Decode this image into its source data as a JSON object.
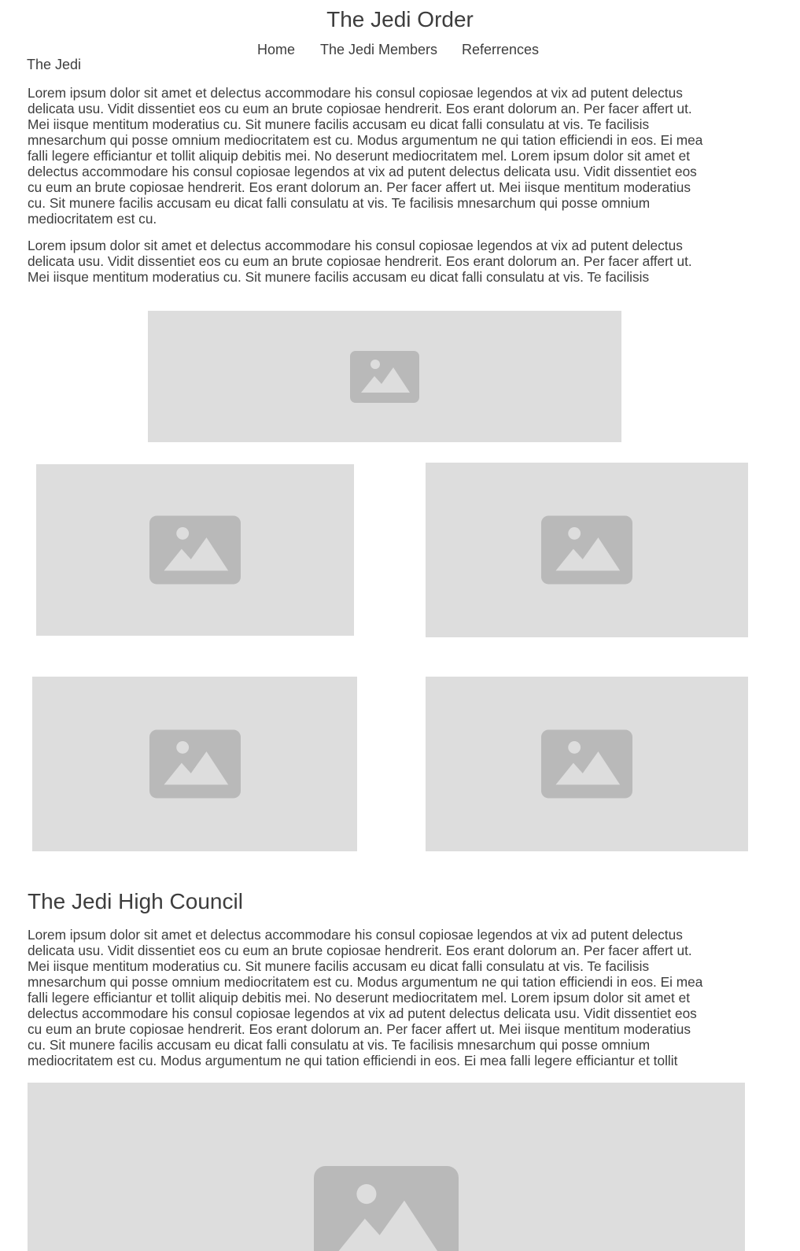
{
  "header": {
    "title": "The Jedi Order"
  },
  "nav": {
    "items": [
      {
        "label": "Home"
      },
      {
        "label": "The Jedi Members"
      },
      {
        "label": "Referrences"
      }
    ]
  },
  "intro": {
    "label": "The Jedi",
    "paragraph1": "Lorem ipsum dolor sit amet et delectus accommodare his consul copiosae legendos at vix ad putent delectus\ndelicata usu. Vidit dissentiet eos cu eum an brute copiosae hendrerit. Eos erant dolorum an. Per facer affert ut.\nMei iisque mentitum moderatius cu. Sit munere facilis accusam eu dicat falli consulatu at vis. Te facilisis\nmnesarchum qui posse omnium mediocritatem est cu. Modus argumentum ne qui tation efficiendi in eos. Ei mea\nfalli legere efficiantur et tollit aliquip debitis mei. No deserunt mediocritatem mel. Lorem ipsum dolor sit amet et\ndelectus accommodare his consul copiosae legendos at vix ad putent delectus delicata usu. Vidit dissentiet eos\ncu eum an brute copiosae hendrerit. Eos erant dolorum an. Per facer affert ut. Mei iisque mentitum moderatius\ncu. Sit munere facilis accusam eu dicat falli consulatu at vis. Te facilisis mnesarchum qui posse omnium\nmediocritatem est cu.",
    "paragraph2": "Lorem ipsum dolor sit amet et delectus accommodare his consul copiosae legendos at vix ad putent delectus\ndelicata usu. Vidit dissentiet eos cu eum an brute copiosae hendrerit. Eos erant dolorum an. Per facer affert ut.\nMei iisque mentitum moderatius cu. Sit munere facilis accusam eu dicat falli consulatu at vis. Te facilisis"
  },
  "council": {
    "heading": "The Jedi High Council",
    "paragraph": "Lorem ipsum dolor sit amet et delectus accommodare his consul copiosae legendos at vix ad putent delectus\ndelicata usu. Vidit dissentiet eos cu eum an brute copiosae hendrerit. Eos erant dolorum an. Per facer affert ut.\nMei iisque mentitum moderatius cu. Sit munere facilis accusam eu dicat falli consulatu at vis. Te facilisis\nmnesarchum qui posse omnium mediocritatem est cu. Modus argumentum ne qui tation efficiendi in eos. Ei mea\nfalli legere efficiantur et tollit aliquip debitis mei. No deserunt mediocritatem mel. Lorem ipsum dolor sit amet et\ndelectus accommodare his consul copiosae legendos at vix ad putent delectus delicata usu. Vidit dissentiet eos\ncu eum an brute copiosae hendrerit. Eos erant dolorum an. Per facer affert ut. Mei iisque mentitum moderatius\ncu. Sit munere facilis accusam eu dicat falli consulatu at vis. Te facilisis mnesarchum qui posse omnium\nmediocritatem est cu. Modus argumentum ne qui tation efficiendi in eos. Ei mea falli legere efficiantur et tollit"
  },
  "images": {
    "icon": "image-placeholder-icon",
    "background_color": "#dddddd",
    "icon_color": "#b9b9b9"
  }
}
